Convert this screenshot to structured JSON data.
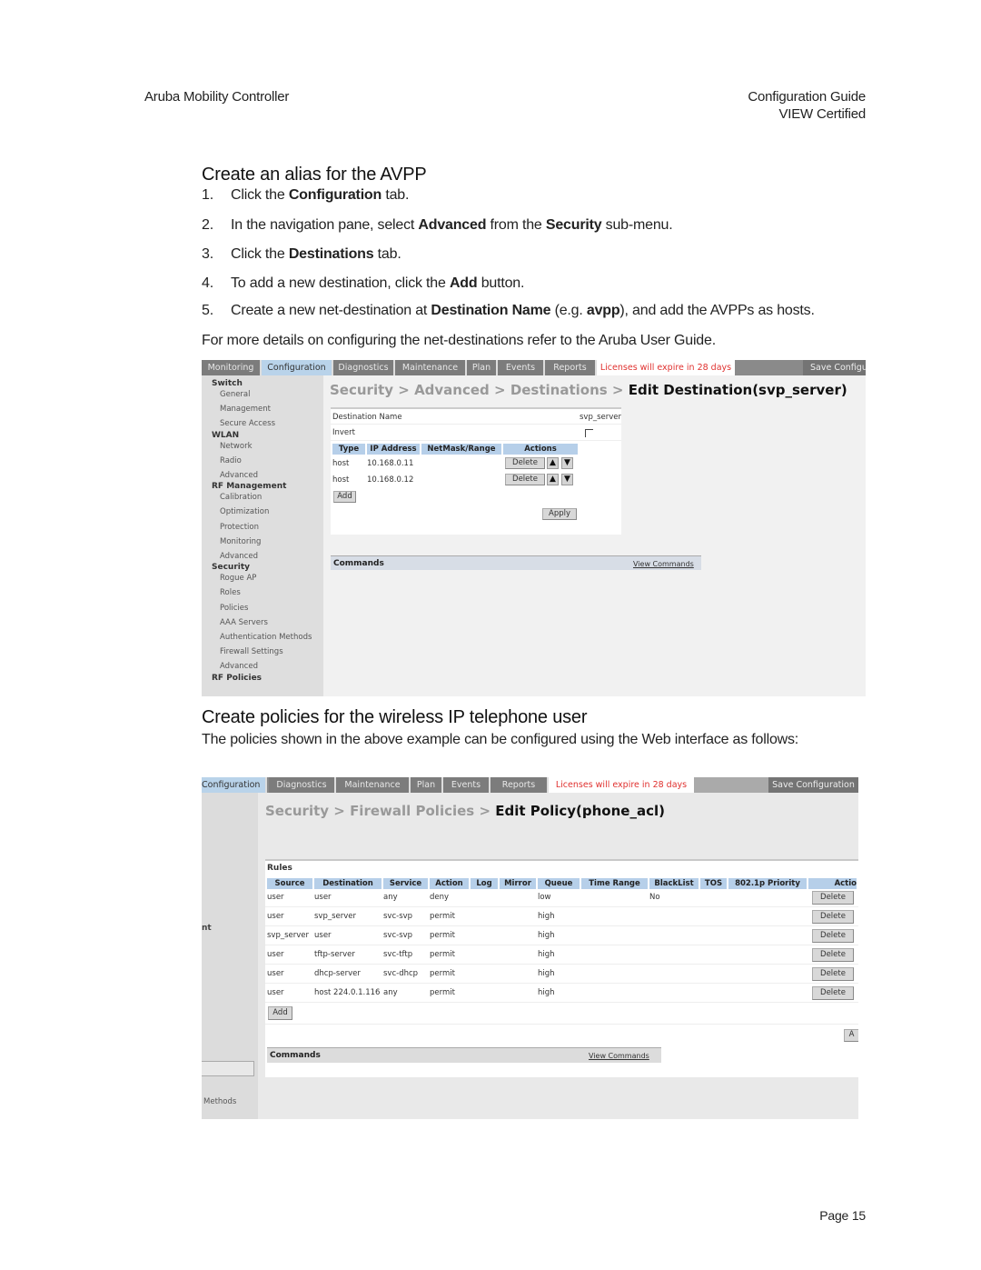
{
  "header": {
    "left": "Aruba Mobility Controller",
    "right_line1": "Configuration Guide",
    "right_line2": "VIEW Certified"
  },
  "section1": {
    "title": "Create an alias for the AVPP",
    "steps": [
      {
        "num": "1.",
        "parts": [
          "Click the ",
          "Configuration",
          " tab."
        ]
      },
      {
        "num": "2.",
        "parts": [
          "In the navigation pane, select ",
          "Advanced",
          " from the ",
          "Security",
          " sub-menu."
        ]
      },
      {
        "num": "3.",
        "parts": [
          "Click the ",
          "Destinations",
          " tab."
        ]
      },
      {
        "num": "4.",
        "parts": [
          "To add a new destination, click the ",
          "Add",
          " button."
        ]
      },
      {
        "num": "5.",
        "parts": [
          "Create a new net-destination at ",
          "Destination Name",
          " (e.g. ",
          "avpp",
          "), and add the AVPPs as hosts."
        ]
      }
    ],
    "note": "For more details on configuring the net-destinations refer to the Aruba User Guide."
  },
  "screenshot1": {
    "tabs": [
      "Monitoring",
      "Configuration",
      "Diagnostics",
      "Maintenance",
      "Plan",
      "Events",
      "Reports"
    ],
    "active_tab": "Configuration",
    "license_notice": "Licenses will expire in 28 days",
    "save_button": "Save Configu",
    "nav": [
      {
        "section": "Switch",
        "items": [
          "General",
          "Management",
          "Secure Access"
        ]
      },
      {
        "section": "WLAN",
        "items": [
          "Network",
          "Radio",
          "Advanced"
        ]
      },
      {
        "section": "RF Management",
        "items": [
          "Calibration",
          "Optimization",
          "Protection",
          "Monitoring",
          "Advanced"
        ]
      },
      {
        "section": "Security",
        "items": [
          "Rogue AP",
          "Roles",
          "Policies",
          "AAA Servers",
          "Authentication Methods",
          "Firewall Settings",
          "Advanced"
        ]
      },
      {
        "section": "RF Policies",
        "items": []
      }
    ],
    "breadcrumb": {
      "parts": [
        "Security",
        "Advanced",
        "Destinations"
      ],
      "sep": " > ",
      "current": "Edit Destination(svp_server)"
    },
    "destination_name_label": "Destination Name",
    "destination_name_value": "svp_server",
    "invert_label": "Invert",
    "invert_checked": false,
    "table_headers": [
      "Type",
      "IP Address",
      "NetMask/Range",
      "Actions"
    ],
    "rows": [
      {
        "type": "host",
        "ip": "10.168.0.11",
        "mask": "",
        "action": "Delete"
      },
      {
        "type": "host",
        "ip": "10.168.0.12",
        "mask": "",
        "action": "Delete"
      }
    ],
    "add_button": "Add",
    "apply_button": "Apply",
    "commands_label": "Commands",
    "view_commands": "View Commands"
  },
  "section2": {
    "title": "Create policies for the wireless IP telephone user",
    "body": "The policies shown in the above example can be configured using the Web interface as follows:"
  },
  "screenshot2": {
    "tabs": [
      "Configuration",
      "Diagnostics",
      "Maintenance",
      "Plan",
      "Events",
      "Reports"
    ],
    "active_tab": "Configuration",
    "license_notice": "Licenses will expire in 28 days",
    "save_button": "Save Configuration",
    "breadcrumb": {
      "parts": [
        "Security",
        "Firewall Policies"
      ],
      "sep": " > ",
      "current": "Edit Policy(phone_acl)"
    },
    "nav_fragments": [
      "nt",
      "Methods"
    ],
    "rules_label": "Rules",
    "headers": [
      "Source",
      "Destination",
      "Service",
      "Action",
      "Log",
      "Mirror",
      "Queue",
      "Time Range",
      "BlackList",
      "TOS",
      "802.1p Priority",
      "Actio"
    ],
    "rules": [
      {
        "source": "user",
        "destination": "user",
        "service": "any",
        "action": "deny",
        "log": "",
        "mirror": "",
        "queue": "low",
        "time_range": "",
        "blacklist": "No",
        "tos": "",
        "priority": "",
        "delete": "Delete"
      },
      {
        "source": "user",
        "destination": "svp_server",
        "service": "svc-svp",
        "action": "permit",
        "log": "",
        "mirror": "",
        "queue": "high",
        "time_range": "",
        "blacklist": "",
        "tos": "",
        "priority": "",
        "delete": "Delete"
      },
      {
        "source": "svp_server",
        "destination": "user",
        "service": "svc-svp",
        "action": "permit",
        "log": "",
        "mirror": "",
        "queue": "high",
        "time_range": "",
        "blacklist": "",
        "tos": "",
        "priority": "",
        "delete": "Delete"
      },
      {
        "source": "user",
        "destination": "tftp-server",
        "service": "svc-tftp",
        "action": "permit",
        "log": "",
        "mirror": "",
        "queue": "high",
        "time_range": "",
        "blacklist": "",
        "tos": "",
        "priority": "",
        "delete": "Delete"
      },
      {
        "source": "user",
        "destination": "dhcp-server",
        "service": "svc-dhcp",
        "action": "permit",
        "log": "",
        "mirror": "",
        "queue": "high",
        "time_range": "",
        "blacklist": "",
        "tos": "",
        "priority": "",
        "delete": "Delete"
      },
      {
        "source": "user",
        "destination": "host 224.0.1.116",
        "service": "any",
        "action": "permit",
        "log": "",
        "mirror": "",
        "queue": "high",
        "time_range": "",
        "blacklist": "",
        "tos": "",
        "priority": "",
        "delete": "Delete"
      }
    ],
    "add_button": "Add",
    "apply_button_fragment": "A",
    "commands_label": "Commands",
    "view_commands": "View Commands"
  },
  "footer": {
    "page": "Page 15"
  },
  "colors": {
    "license_red": "#e0312f",
    "active_tab": "#b9d3ea",
    "table_header": "#b6cfe9",
    "tab_gray": "#7c7c7c"
  }
}
